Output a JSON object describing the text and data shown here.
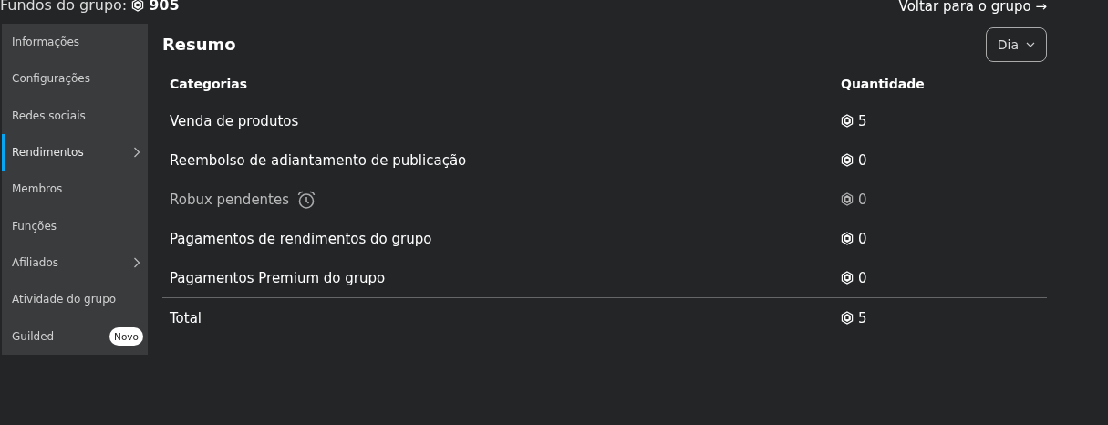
{
  "header": {
    "funds_label": "Fundos do grupo:",
    "funds_value": "905",
    "back_link": "Voltar para o grupo →"
  },
  "sidebar": {
    "items": [
      {
        "label": "Informações",
        "selected": false,
        "submenu": false
      },
      {
        "label": "Configurações",
        "selected": false,
        "submenu": false
      },
      {
        "label": "Redes sociais",
        "selected": false,
        "submenu": false
      },
      {
        "label": "Rendimentos",
        "selected": true,
        "submenu": true
      },
      {
        "label": "Membros",
        "selected": false,
        "submenu": false
      },
      {
        "label": "Funções",
        "selected": false,
        "submenu": false
      },
      {
        "label": "Afiliados",
        "selected": false,
        "submenu": true
      },
      {
        "label": "Atividade do grupo",
        "selected": false,
        "submenu": false
      },
      {
        "label": "Guilded",
        "selected": false,
        "submenu": false,
        "badge": "Novo"
      }
    ]
  },
  "summary": {
    "title": "Resumo",
    "period": "Dia",
    "table": {
      "columns": [
        "Categorias",
        "Quantidade"
      ],
      "rows": [
        {
          "category": "Venda de produtos",
          "amount": "5",
          "pending": false
        },
        {
          "category": "Reembolso de adiantamento de publicação",
          "amount": "0",
          "pending": false
        },
        {
          "category": "Robux pendentes",
          "amount": "0",
          "pending": true
        },
        {
          "category": "Pagamentos de rendimentos do grupo",
          "amount": "0",
          "pending": false
        },
        {
          "category": "Pagamentos Premium do grupo",
          "amount": "0",
          "pending": false
        }
      ],
      "total": {
        "label": "Total",
        "amount": "5"
      }
    }
  }
}
